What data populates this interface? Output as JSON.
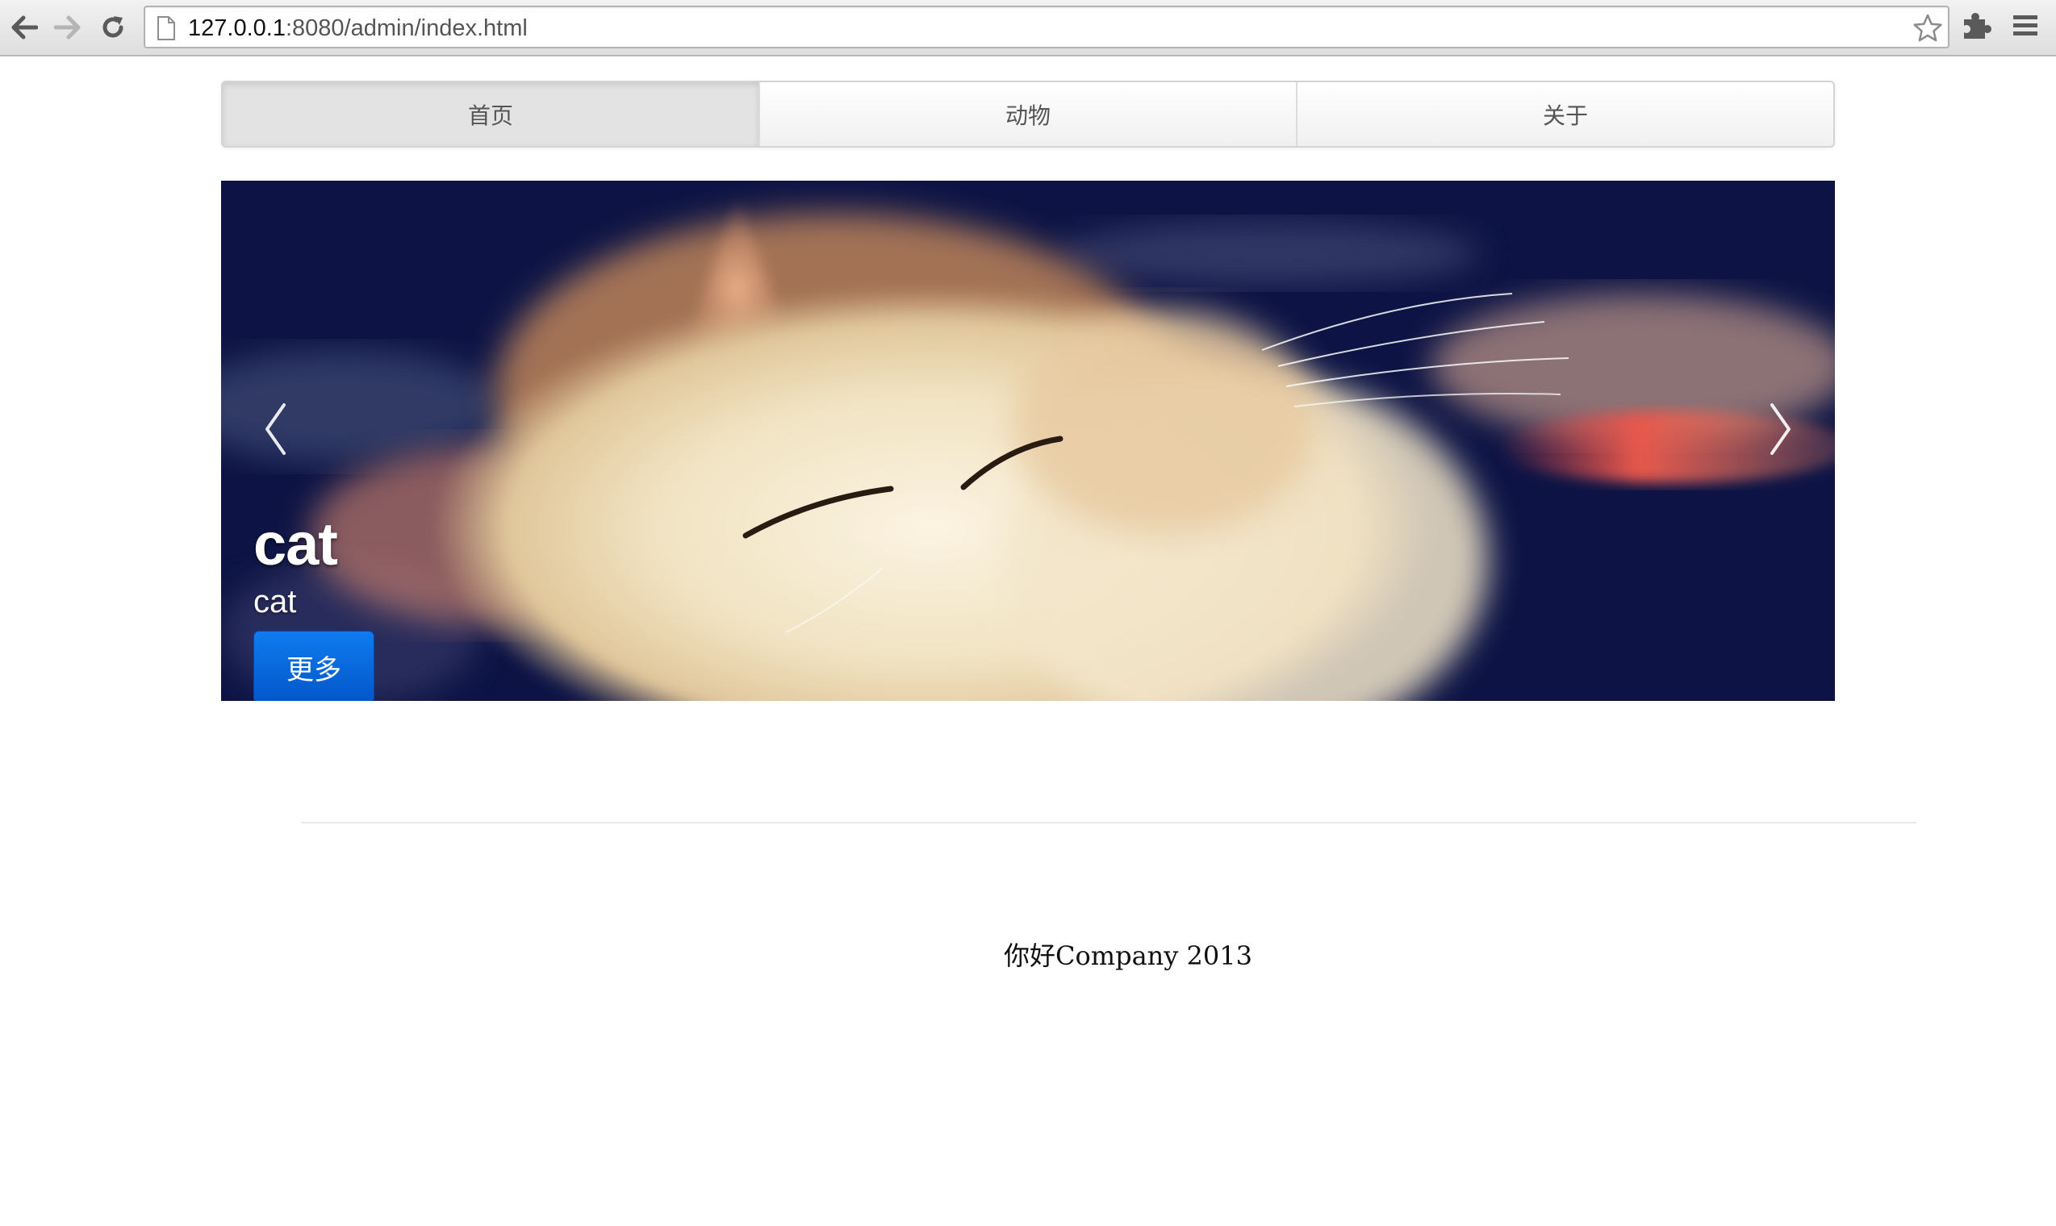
{
  "browser": {
    "url_host": "127.0.0.1",
    "url_rest": ":8080/admin/index.html"
  },
  "navbar": {
    "items": [
      {
        "label": "首页",
        "active": true
      },
      {
        "label": "动物",
        "active": false
      },
      {
        "label": "关于",
        "active": false
      }
    ]
  },
  "carousel": {
    "title": "cat",
    "subtitle": "cat",
    "button_label": "更多"
  },
  "footer": {
    "text": "你好Company 2013"
  },
  "colors": {
    "button_primary": "#0a6be0",
    "carousel_background": "#0d1445",
    "navbar_active": "#e3e3e3"
  },
  "icons": {
    "back": "arrow-left-icon",
    "forward": "arrow-right-icon",
    "reload": "reload-icon",
    "page": "page-icon",
    "bookmark": "star-icon",
    "extensions": "puzzle-icon",
    "menu": "hamburger-menu-icon",
    "carousel_prev": "chevron-left-icon",
    "carousel_next": "chevron-right-icon"
  }
}
